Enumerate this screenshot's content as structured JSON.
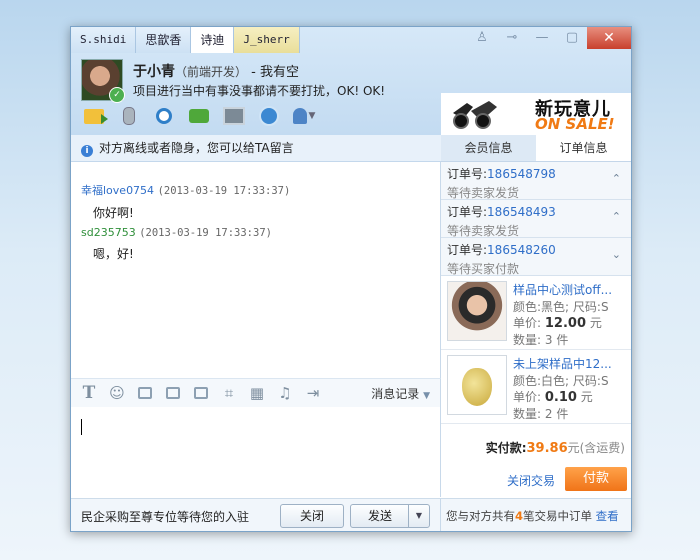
{
  "tabs": [
    "S.shidi",
    "思歆香",
    "诗迪",
    "J_sherr"
  ],
  "window_controls": {
    "close": "✕"
  },
  "contact": {
    "name": "于小青",
    "role": "（前端开发）",
    "status": " - 我有空",
    "signature": "项目进行当中有事没事都请不要打扰，OK! OK!"
  },
  "ad": {
    "title": "新玩意儿",
    "subtitle": "ON SALE!"
  },
  "notice": "对方离线或者隐身，您可以给TA留言",
  "messages": [
    {
      "sender": "幸福love0754",
      "time": "(2013-03-19 17:33:37)",
      "text": "你好啊!"
    },
    {
      "sender": "sd235753",
      "time": "(2013-03-19 17:33:37)",
      "text": "嗯，好!"
    }
  ],
  "format_bar": {
    "history_label": "消息记录"
  },
  "bottom": {
    "promo_text": "民企采购至尊专位等待您的入驻",
    "close_label": "关闭",
    "send_label": "发送"
  },
  "right_tabs": [
    "会员信息",
    "订单信息"
  ],
  "orders": [
    {
      "label": "订单号:",
      "no": "186548798",
      "status": "等待卖家发货",
      "arrow": "⌃"
    },
    {
      "label": "订单号:",
      "no": "186548493",
      "status": "等待卖家发货",
      "arrow": "⌃"
    },
    {
      "label": "订单号:",
      "no": "186548260",
      "status": "等待买家付款",
      "arrow": "⌄"
    }
  ],
  "items": [
    {
      "name": "样品中心测试off...",
      "spec": "颜色:黑色; 尺码:S",
      "price_label": "单价:",
      "price": "12.00",
      "price_unit": "元",
      "qty_label": "数量:",
      "qty": "3 件"
    },
    {
      "name": "未上架样品中12...",
      "spec": "颜色:白色; 尺码:S",
      "price_label": "单价:",
      "price": "0.10",
      "price_unit": "元",
      "qty_label": "数量:",
      "qty": "2 件"
    }
  ],
  "total": {
    "label": "实付款:",
    "amount": "39.86",
    "note": "元(含运费)"
  },
  "actions": {
    "close_trade": "关闭交易",
    "pay": "付款"
  },
  "footer": {
    "pre": "您与对方共有",
    "count": "4",
    "post": "笔交易中订单",
    "link": "查看"
  },
  "colors": {
    "accent": "#f07a14",
    "link": "#2f6ec8"
  }
}
